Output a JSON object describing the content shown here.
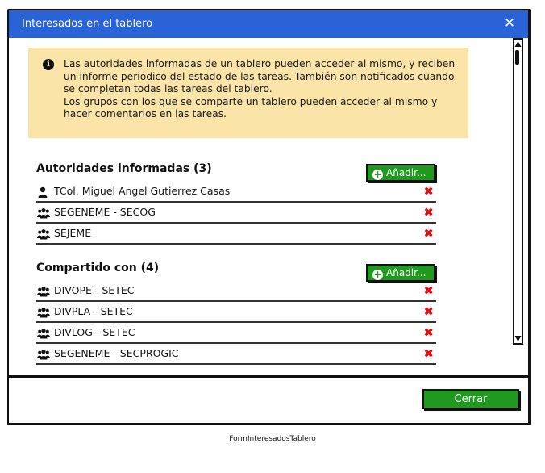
{
  "dialog": {
    "title": "Interesados en el tablero",
    "close_icon": "close-icon"
  },
  "info": {
    "icon": "info-icon",
    "paragraph1": "Las autoridades informadas de un tablero pueden acceder al mismo, y reciben un informe periódico del estado de las tareas. También son notificados cuando se completan todas las tareas del tablero.",
    "paragraph2": "Los grupos con los que se comparte un tablero pueden acceder al mismo y hacer comentarios en las tareas."
  },
  "authorities": {
    "title": "Autoridades informadas (3)",
    "add_label": "Añadir...",
    "items": [
      {
        "label": "TCol. Miguel Angel Gutierrez Casas",
        "icon": "user-icon"
      },
      {
        "label": "SEGENEME - SECOG",
        "icon": "group-icon"
      },
      {
        "label": "SEJEME",
        "icon": "group-icon"
      }
    ]
  },
  "shared": {
    "title": "Compartido con (4)",
    "add_label": "Añadir...",
    "items": [
      {
        "label": "DIVOPE - SETEC",
        "icon": "group-icon"
      },
      {
        "label": "DIVPLA - SETEC",
        "icon": "group-icon"
      },
      {
        "label": "DIVLOG - SETEC",
        "icon": "group-icon"
      },
      {
        "label": "SEGENEME - SECPROGIC",
        "icon": "group-icon"
      }
    ]
  },
  "footer": {
    "close_label": "Cerrar"
  },
  "caption": "FormInteresadosTablero",
  "colors": {
    "titlebar": "#2a62d8",
    "info_bg": "#fbe4a8",
    "button_green": "#1f9a1f",
    "delete_red": "#e01010"
  }
}
